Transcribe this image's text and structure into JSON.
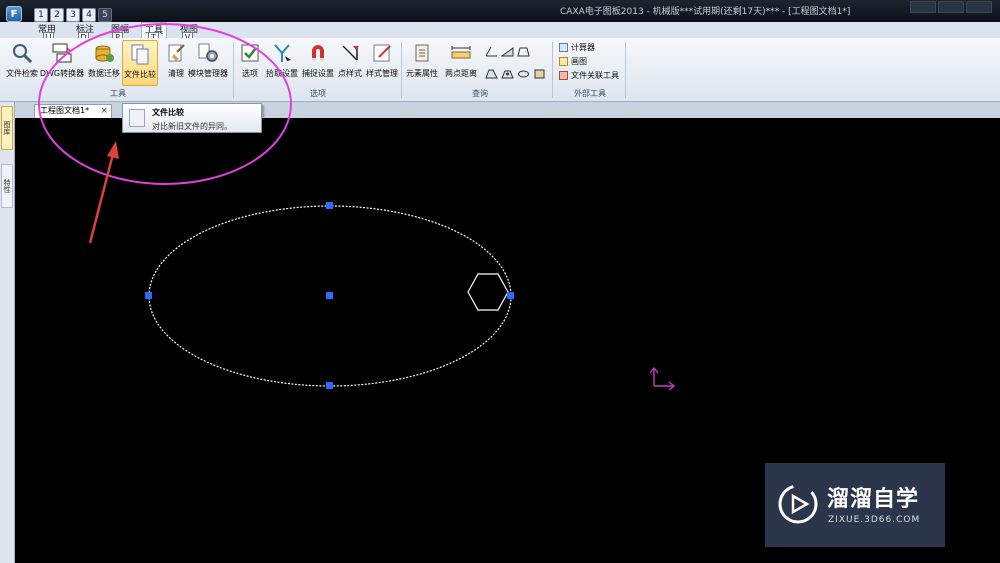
{
  "window": {
    "title": "CAXA电子图板2013 - 机械版***试用期(还剩17天)***  - [工程图文档1*]",
    "app_icon_letter": "F"
  },
  "quick_access": [
    "1",
    "2",
    "3",
    "4",
    "5"
  ],
  "ribbon_tabs": [
    {
      "label": "常用",
      "key": "U"
    },
    {
      "label": "标注",
      "key": "D"
    },
    {
      "label": "图幅",
      "key": "P"
    },
    {
      "label": "工具",
      "key": "T"
    },
    {
      "label": "视图",
      "key": "V"
    }
  ],
  "ribbon": {
    "group_tools": {
      "label": "工具",
      "buttons": [
        "文件检索",
        "DWG转换器",
        "数据迁移",
        "文件比较",
        "清理",
        "模块管理器"
      ]
    },
    "group_options": {
      "label": "选项",
      "buttons": [
        "选项",
        "拾取设置",
        "捕捉设置",
        "点样式",
        "样式管理"
      ]
    },
    "group_query": {
      "label": "查询",
      "buttons": [
        "元素属性",
        "两点距离"
      ]
    },
    "group_external": {
      "label": "外部工具",
      "items": [
        "计算器",
        "画图",
        "文件关联工具"
      ]
    }
  },
  "document": {
    "tab_label": "工程图文档1*",
    "close_glyph": "×"
  },
  "tooltip": {
    "title": "文件比较",
    "description": "对比新旧文件的异同。"
  },
  "left_dock": [
    "图库",
    "特性"
  ],
  "watermark": {
    "title": "溜溜自学",
    "subtitle": "ZIXUE.3D66.COM"
  },
  "colors": {
    "annotation_circle": "#e040e0",
    "annotation_arrow": "#e0403a",
    "grip": "#2b6cff",
    "ucs": "#c040c0"
  }
}
